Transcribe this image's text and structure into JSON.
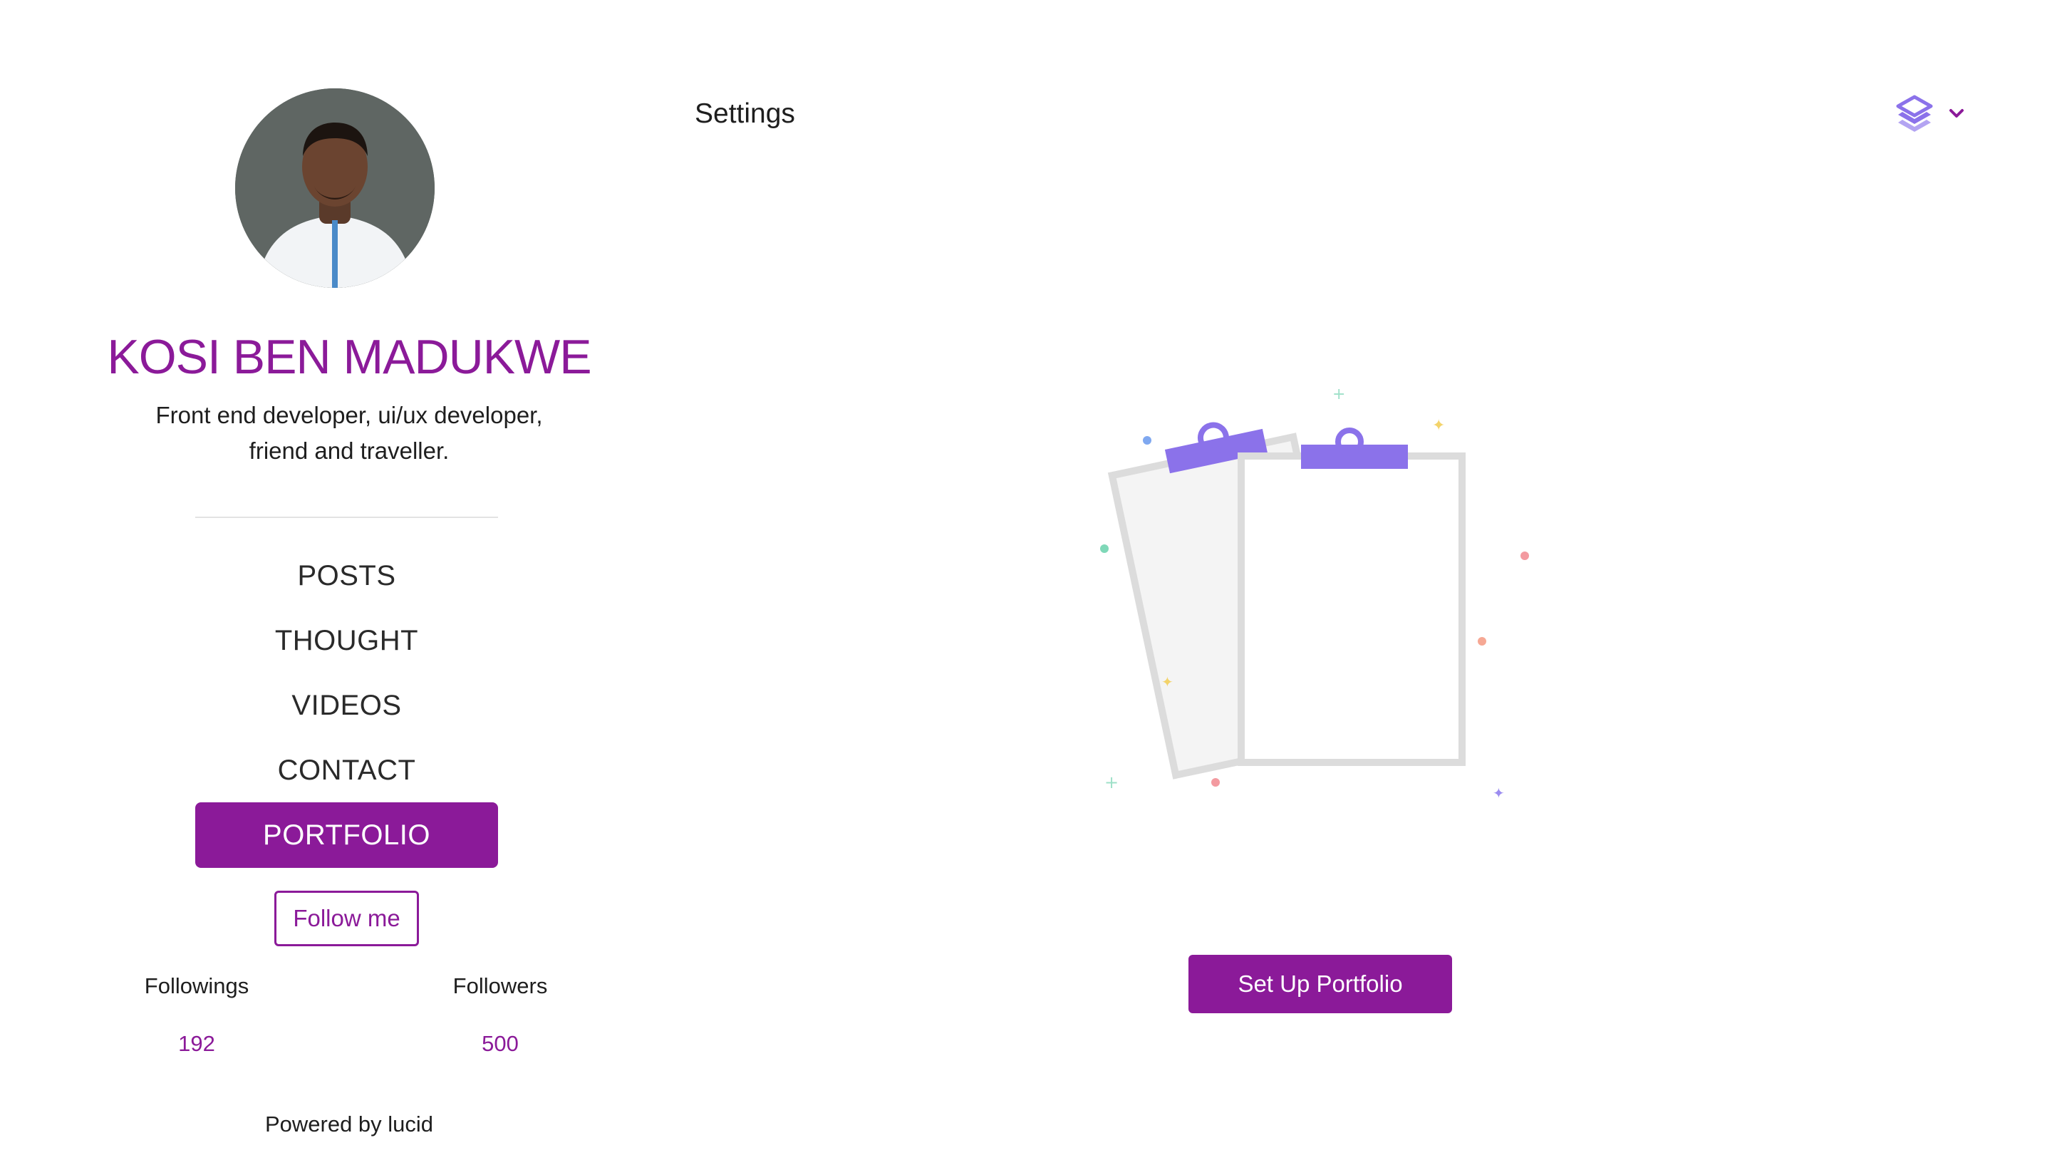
{
  "header": {
    "title": "Settings",
    "logo_icon": "layers-logo-icon",
    "menu_icon": "chevron-down-icon"
  },
  "profile": {
    "name": "KOSI BEN MADUKWE",
    "bio_line1": "Front end developer, ui/ux developer,",
    "bio_line2": "friend and traveller."
  },
  "nav": {
    "items": [
      {
        "label": "POSTS"
      },
      {
        "label": "THOUGHT"
      },
      {
        "label": "VIDEOS"
      },
      {
        "label": "CONTACT"
      },
      {
        "label": "PORTFOLIO",
        "active": true
      }
    ]
  },
  "follow": {
    "label": "Follow me"
  },
  "stats": {
    "followings_label": "Followings",
    "followings_value": "192",
    "followers_label": "Followers",
    "followers_value": "500"
  },
  "footer": {
    "powered_by": "Powered by lucid"
  },
  "main": {
    "illustration": "empty-clipboards-illustration",
    "setup_button": "Set Up Portfolio"
  },
  "colors": {
    "brand": "#8b1a99",
    "accent_light": "#8b72ea",
    "text": "#1e1e1e"
  }
}
